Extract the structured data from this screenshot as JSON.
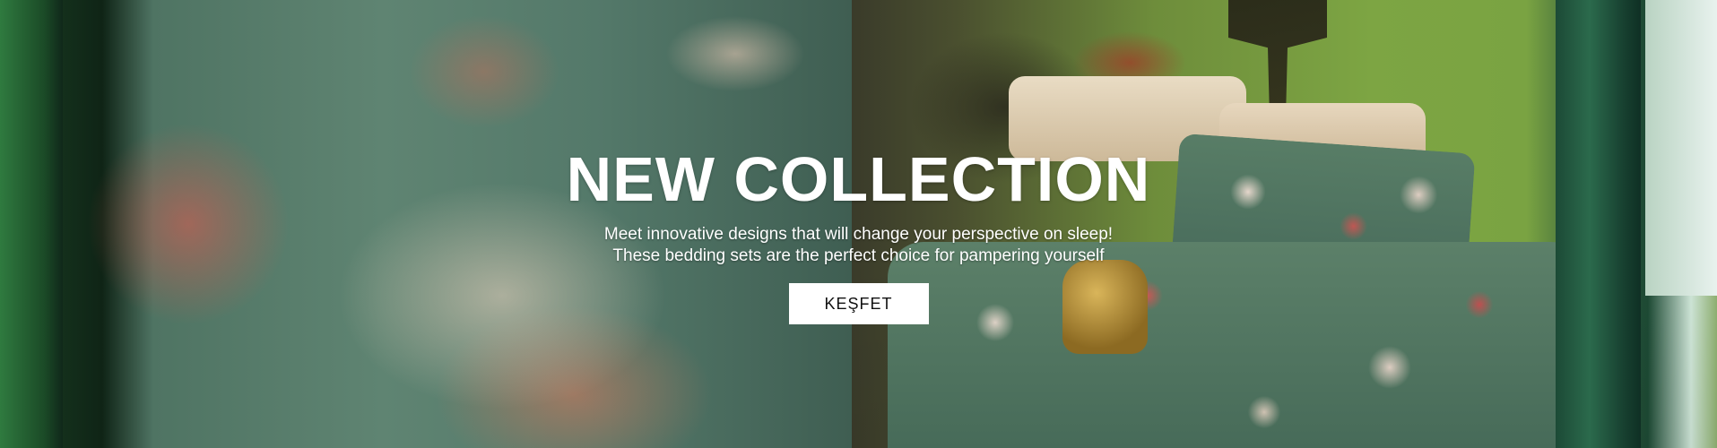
{
  "hero": {
    "title": "NEW COLLECTION",
    "subtitle_line1": "Meet innovative designs that will change your perspective on sleep!",
    "subtitle_line2": "These bedding sets are the perfect choice for pampering yourself",
    "cta_label": "KEŞFET"
  },
  "colors": {
    "title_text": "#ffffff",
    "cta_background": "#ffffff",
    "cta_text": "#111111"
  }
}
